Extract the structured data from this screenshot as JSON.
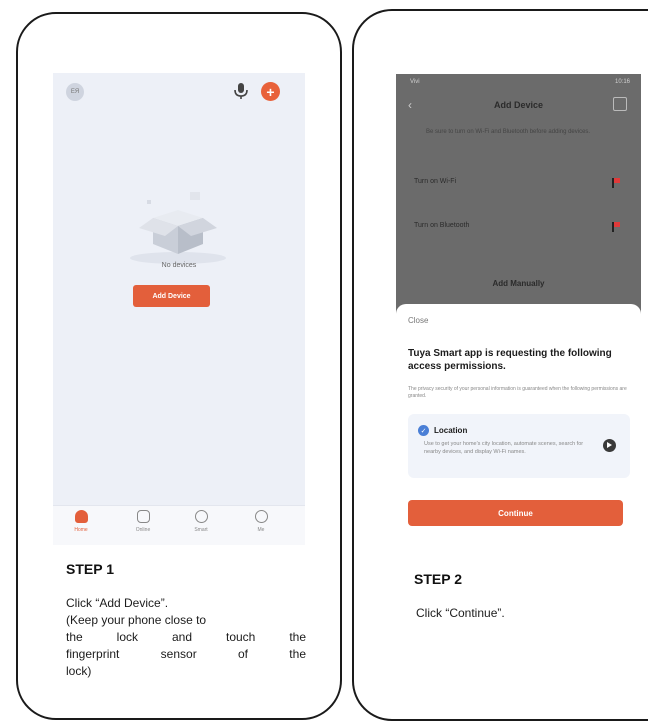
{
  "step1": {
    "avatar_label": "ЕЯ",
    "no_devices": "No devices",
    "add_device_button": "Add Device",
    "tabs": [
      {
        "label": "Home",
        "icon": "home-icon"
      },
      {
        "label": "Online",
        "icon": "scene-icon"
      },
      {
        "label": "Smart",
        "icon": "smart-icon"
      },
      {
        "label": "Me",
        "icon": "profile-icon"
      }
    ],
    "title": "STEP 1",
    "caption_lines": [
      "Click “Add Device”.",
      "(Keep your phone close to",
      "the lock and touch the",
      "fingerprint sensor of the",
      "lock)"
    ]
  },
  "step2": {
    "status_left": "Vivi",
    "status_right": "10:16",
    "screen_title": "Add Device",
    "hint": "Be sure to turn on Wi-Fi and Bluetooth before adding devices.",
    "rows": [
      "Turn on Wi-Fi",
      "Turn on Bluetooth"
    ],
    "add_manually": "Add Manually",
    "sheet": {
      "close": "Close",
      "heading": "Tuya Smart app is requesting the following access permissions.",
      "subtext": "The privacy security of your personal information is guaranteed when the following permissions are granted.",
      "permission_title": "Location",
      "permission_desc": "Use to get your home's city location, automate scenes, search for nearby devices, and display Wi-Fi names.",
      "continue_button": "Continue"
    },
    "title": "STEP 2",
    "caption": "Click  “Continue”."
  },
  "colors": {
    "accent": "#e35f3b",
    "check": "#4a7fd6"
  }
}
